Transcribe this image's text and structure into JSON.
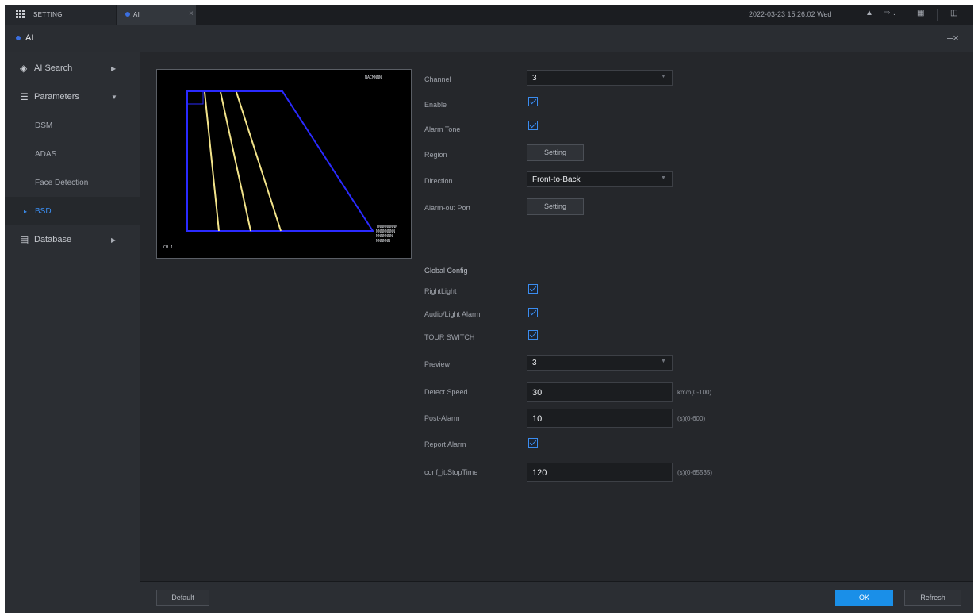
{
  "topbar": {
    "setting_tab": "SETTING",
    "ai_tab": "AI",
    "close_tab": "×",
    "datetime": "2022-03-23 15:26:02 Wed"
  },
  "titlebar": {
    "title": "AI",
    "window_controls": "–×"
  },
  "sidebar": {
    "ai_search": "AI Search",
    "parameters": "Parameters",
    "items": [
      "DSM",
      "ADAS",
      "Face Detection",
      "BSD"
    ],
    "database": "Database",
    "selected": "BSD"
  },
  "preview": {
    "top_right_text": "NACMNNN",
    "bottom_left_text": "CH 1",
    "bottom_right_lines": [
      "TNNNNNNNN",
      "NNNNNNNN",
      "NNNNNNN",
      "NNNNNN"
    ]
  },
  "form": {
    "channel_label": "Channel",
    "channel_value": "3",
    "enable_label": "Enable",
    "alarm_tone_label": "Alarm Tone",
    "region_label": "Region",
    "region_button": "Setting",
    "direction_label": "Direction",
    "direction_value": "Front-to-Back",
    "alarm_out_label": "Alarm-out Port",
    "alarm_out_button": "Setting",
    "global_config": "Global Config",
    "right_light_label": "RightLight",
    "audio_light_label": "Audio/Light Alarm",
    "tour_switch_label": "TOUR SWITCH",
    "preview_label": "Preview",
    "preview_value": "3",
    "detect_speed_label": "Detect Speed",
    "detect_speed_value": "30",
    "detect_speed_unit": "km/h(0-100)",
    "post_alarm_label": "Post-Alarm",
    "post_alarm_value": "10",
    "post_alarm_unit": "(s)(0-600)",
    "report_alarm_label": "Report Alarm",
    "stop_time_label": "conf_it.StopTime",
    "stop_time_value": "120",
    "stop_time_unit": "(s)(0-65535)"
  },
  "footer": {
    "default": "Default",
    "ok": "OK",
    "refresh": "Refresh"
  },
  "colors": {
    "accent": "#1a8fe8",
    "selected_text": "#3b8df0",
    "region_outline": "#2a2aff",
    "lane_lines": "#f2e38a"
  }
}
